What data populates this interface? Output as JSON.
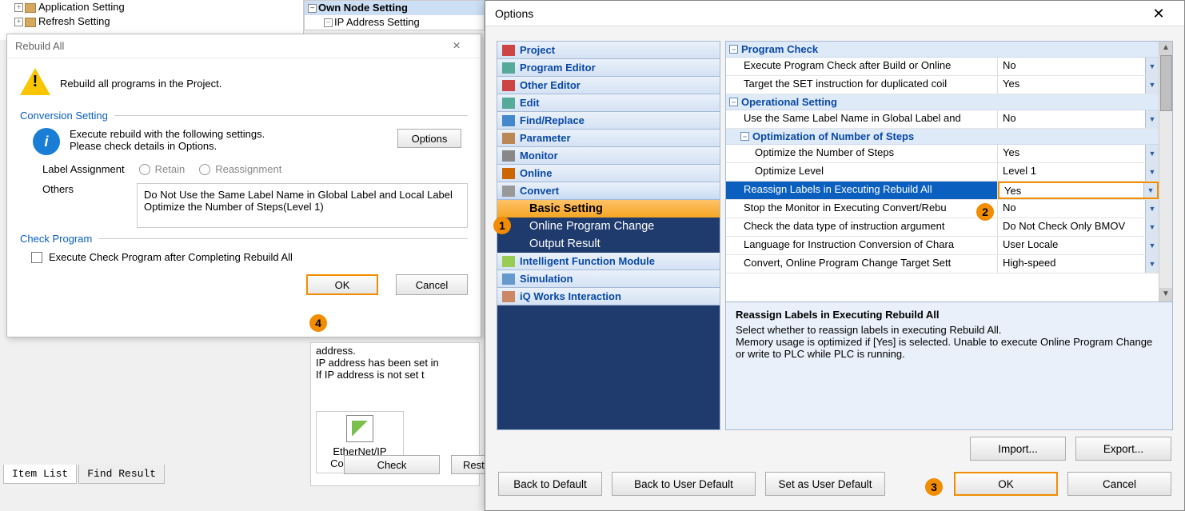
{
  "bg_tree": {
    "item1": "Application Setting",
    "item2": "Refresh Setting"
  },
  "bg_tree2": {
    "row1": "Own Node Setting",
    "row2": "IP Address Setting"
  },
  "rebuild": {
    "title": "Rebuild All",
    "warn": "Rebuild all programs in the Project.",
    "sec1": "Conversion Setting",
    "info1": "Execute rebuild with the following settings.",
    "info2": "Please check details in Options.",
    "btn_options": "Options",
    "lbl_assign": "Label Assignment",
    "radio_retain": "Retain",
    "radio_reassign": "Reassignment",
    "lbl_others": "Others",
    "others_line1": "Do Not Use the Same Label Name in Global Label and Local Label",
    "others_line2": "Optimize the Number of Steps(Level 1)",
    "sec2": "Check Program",
    "chk": "Execute Check Program after Completing Rebuild All",
    "ok": "OK",
    "cancel": "Cancel"
  },
  "bottom_tabs": {
    "t1": "Item List",
    "t2": "Find Result"
  },
  "mid": {
    "l1": "address.",
    "l2": "IP address has been set in",
    "l3": "If IP address is not set  t",
    "icon_label": "EtherNet/IP Configurati...",
    "btn_check": "Check",
    "btn_restore": "Restore S"
  },
  "options": {
    "title": "Options",
    "cats": {
      "project": "Project",
      "progedit": "Program Editor",
      "othedit": "Other Editor",
      "edit": "Edit",
      "find": "Find/Replace",
      "param": "Parameter",
      "monitor": "Monitor",
      "online": "Online",
      "convert": "Convert",
      "convert_sub1": "Basic Setting",
      "convert_sub2": "Online Program Change",
      "convert_sub3": "Output Result",
      "ifm": "Intelligent Function Module",
      "sim": "Simulation",
      "iq": "iQ Works Interaction"
    },
    "grid": {
      "g1": "Program Check",
      "r1k": "Execute Program Check after Build or Online",
      "r1v": "No",
      "r2k": "Target the SET instruction for duplicated coil",
      "r2v": "Yes",
      "g2": "Operational Setting",
      "r3k": "Use the Same Label Name in Global Label and",
      "r3v": "No",
      "g3": "Optimization of Number of Steps",
      "r4k": "Optimize the Number of Steps",
      "r4v": "Yes",
      "r5k": "Optimize Level",
      "r5v": "Level 1",
      "r6k": "Reassign Labels in Executing Rebuild All",
      "r6v": "Yes",
      "r7k": "Stop the Monitor in Executing Convert/Rebu",
      "r7v": "No",
      "r8k": "Check the data type of instruction argument",
      "r8v": "Do Not Check Only BMOV",
      "r9k": "Language for Instruction Conversion of Chara",
      "r9v": "User Locale",
      "r10k": "Convert, Online Program Change Target Sett",
      "r10v": "High-speed"
    },
    "help": {
      "title": "Reassign Labels in Executing Rebuild All",
      "body": "Select whether to reassign labels in executing Rebuild All.\nMemory usage is optimized if [Yes] is selected. Unable to execute Online Program Change or write to PLC while PLC is running."
    },
    "btns": {
      "import": "Import...",
      "export": "Export...",
      "back_def": "Back to Default",
      "back_user": "Back to User Default",
      "set_user": "Set as User Default",
      "ok": "OK",
      "cancel": "Cancel"
    }
  },
  "callouts": {
    "c1": "1",
    "c2": "2",
    "c3": "3",
    "c4": "4"
  }
}
